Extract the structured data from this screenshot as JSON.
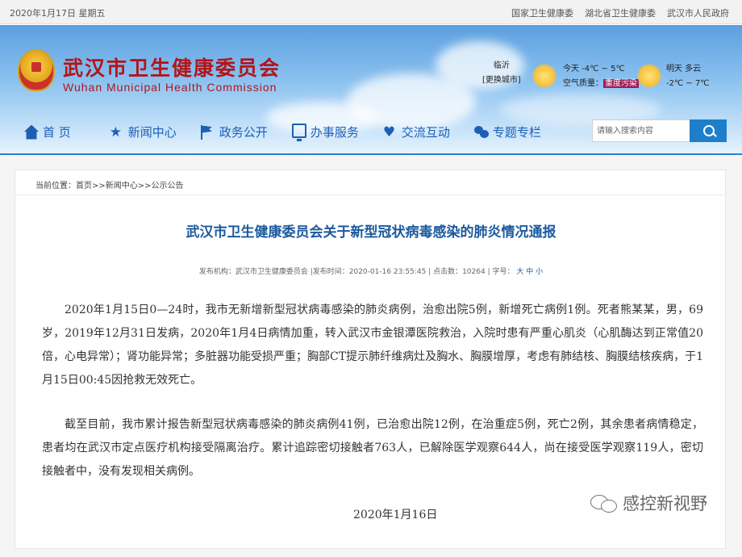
{
  "topbar": {
    "date": "2020年1月17日 星期五",
    "links": [
      "国家卫生健康委",
      "湖北省卫生健康委",
      "武汉市人民政府"
    ]
  },
  "header": {
    "title_cn": "武汉市卫生健康委员会",
    "title_en": "Wuhan Municipal Health Commission"
  },
  "weather": {
    "city": "临沂",
    "change_city": "[更换城市]",
    "today": "今天 -4℃ ~ 5℃",
    "air_label": "空气质量：",
    "air_value": "重度污染",
    "tomorrow": "明天 多云",
    "tomorrow_temp": "-2℃ ~ 7℃"
  },
  "nav": {
    "items": [
      {
        "label": "首 页",
        "icon": "home-icon"
      },
      {
        "label": "新闻中心",
        "icon": "star-icon"
      },
      {
        "label": "政务公开",
        "icon": "flag-icon"
      },
      {
        "label": "办事服务",
        "icon": "monitor-icon"
      },
      {
        "label": "交流互动",
        "icon": "heart-icon"
      },
      {
        "label": "专题专栏",
        "icon": "chat-icon"
      }
    ]
  },
  "search": {
    "placeholder": "请输入搜索内容",
    "icon": "search-icon"
  },
  "breadcrumb": "当前位置：首页>>新闻中心>>公示公告",
  "article": {
    "title": "武汉市卫生健康委员会关于新型冠状病毒感染的肺炎情况通报",
    "meta_prefix": "发布机构：武汉市卫生健康委员会  |发布时间：2020-01-16 23:55:45  | 点击数：10264 | 字号：",
    "font_sizes": [
      "大",
      "中",
      "小"
    ],
    "paragraphs": [
      "2020年1月15日0—24时，我市无新增新型冠状病毒感染的肺炎病例，治愈出院5例，新增死亡病例1例。死者熊某某，男，69岁，2019年12月31日发病，2020年1月4日病情加重，转入武汉市金银潭医院救治，入院时患有严重心肌炎（心肌酶达到正常值20倍，心电异常）；肾功能异常；多脏器功能受损严重；胸部CT提示肺纤维病灶及胸水、胸膜增厚，考虑有肺结核、胸膜结核疾病，于1月15日00:45因抢救无效死亡。",
      "截至目前，我市累计报告新型冠状病毒感染的肺炎病例41例，已治愈出院12例，在治重症5例，死亡2例，其余患者病情稳定，患者均在武汉市定点医疗机构接受隔离治疗。累计追踪密切接触者763人，已解除医学观察644人，尚在接受医学观察119人，密切接触者中，没有发现相关病例。"
    ],
    "signature_date": "2020年1月16日"
  },
  "watermark": "感控新视野"
}
